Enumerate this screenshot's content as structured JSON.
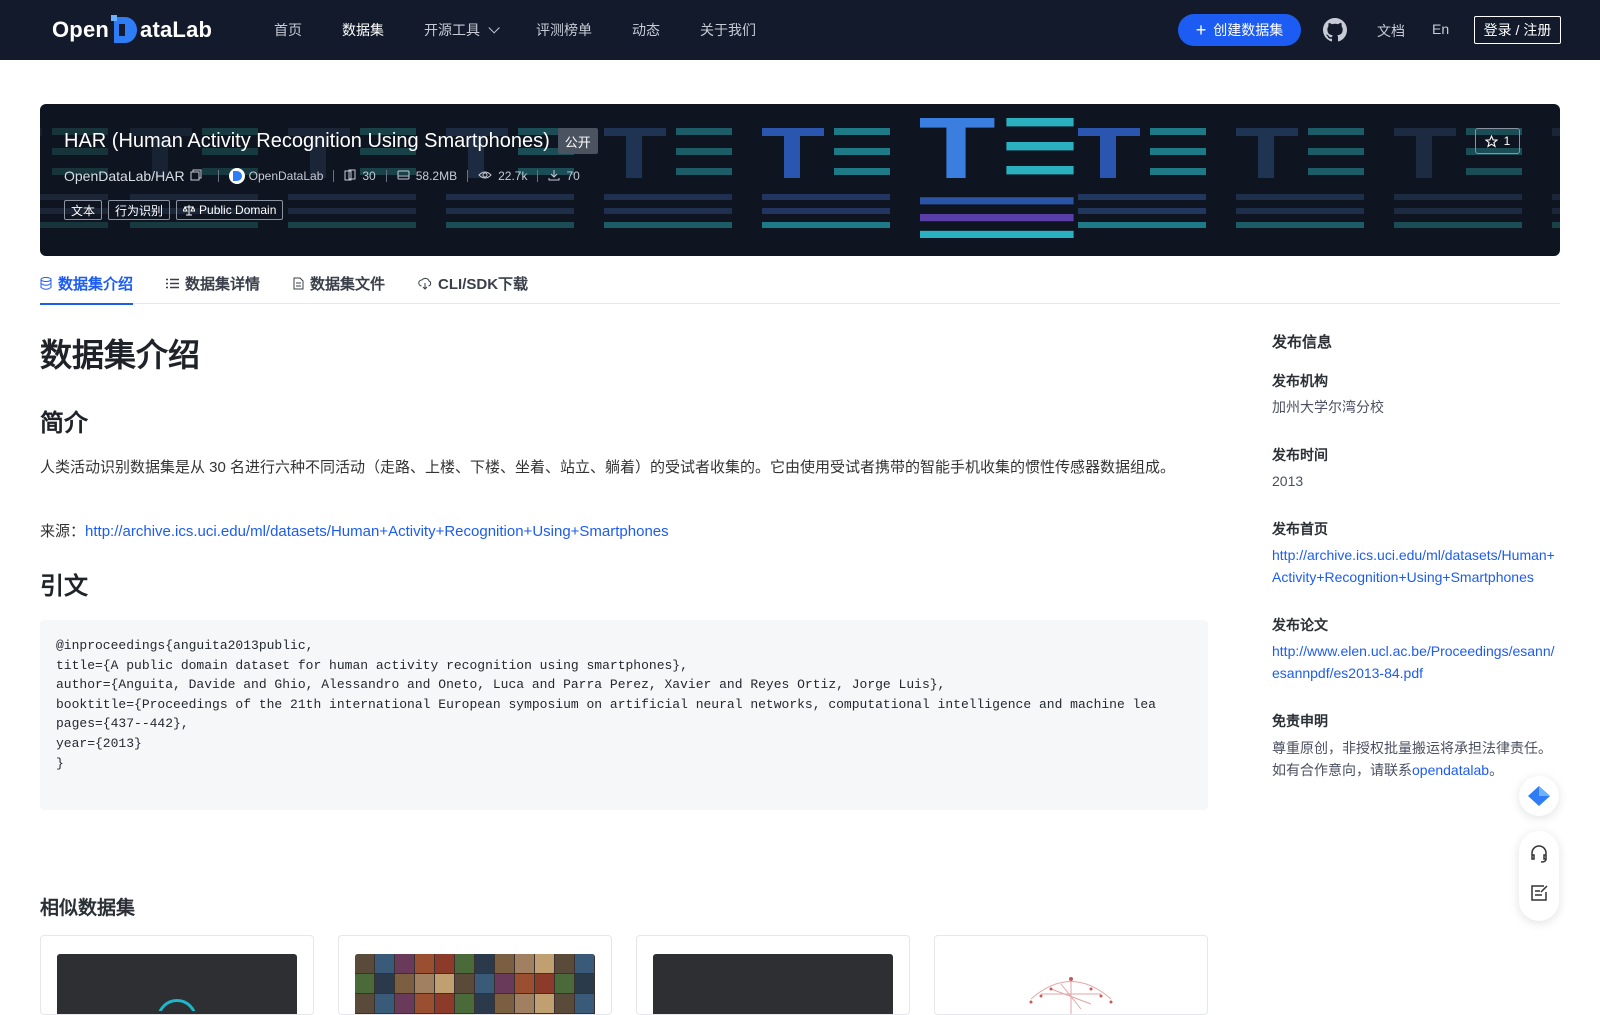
{
  "nav": {
    "logo_text_1": "Open",
    "logo_text_2": "ataLab",
    "links": [
      {
        "label": "首页",
        "active": false
      },
      {
        "label": "数据集",
        "active": true
      },
      {
        "label": "开源工具",
        "active": false,
        "dropdown": true
      },
      {
        "label": "评测榜单",
        "active": false
      },
      {
        "label": "动态",
        "active": false
      },
      {
        "label": "关于我们",
        "active": false
      }
    ],
    "create_label": "创建数据集",
    "doc_label": "文档",
    "lang_label": "En",
    "login_label": "登录 / 注册",
    "accent": "#1d5cf2",
    "bg": "#121a2b"
  },
  "banner": {
    "title": "HAR (Human Activity Recognition Using Smartphones)",
    "visibility": "公开",
    "path": "OpenDataLab/HAR",
    "org": "OpenDataLab",
    "files": "30",
    "size": "58.2MB",
    "views": "22.7k",
    "downloads": "70",
    "tags": [
      "文本",
      "行为识别"
    ],
    "license": "Public Domain",
    "stars": "1"
  },
  "tabs": [
    "数据集介绍",
    "数据集详情",
    "数据集文件",
    "CLI/SDK下载"
  ],
  "main": {
    "title": "数据集介绍",
    "intro_heading": "简介",
    "intro_text": "人类活动识别数据集是从 30 名进行六种不同活动（走路、上楼、下楼、坐着、站立、躺着）的受试者收集的。它由使用受试者携带的智能手机收集的惯性传感器数据组成。",
    "source_label": "来源：",
    "source_url": "http://archive.ics.uci.edu/ml/datasets/Human+Activity+Recognition+Using+Smartphones",
    "citation_heading": "引文",
    "citation": "@inproceedings{anguita2013public,\ntitle={A public domain dataset for human activity recognition using smartphones},\nauthor={Anguita, Davide and Ghio, Alessandro and Oneto, Luca and Parra Perez, Xavier and Reyes Ortiz, Jorge Luis},\nbooktitle={Proceedings of the 21th international European symposium on artificial neural networks, computational intelligence and machine lea\npages={437--442},\nyear={2013}\n}",
    "similar_heading": "相似数据集"
  },
  "sidebar": {
    "title": "发布信息",
    "org_label": "发布机构",
    "org_value": "加州大学尔湾分校",
    "time_label": "发布时间",
    "time_value": "2013",
    "home_label": "发布首页",
    "home_value": "http://archive.ics.uci.edu/ml/datasets/Human+Activity+Recognition+Using+Smartphones",
    "paper_label": "发布论文",
    "paper_value": "http://www.elen.ucl.ac.be/Proceedings/esann/esannpdf/es2013-84.pdf",
    "disclaimer_label": "免责申明",
    "disclaimer_text_1": "尊重原创，非授权批量搬运将承担法律责任。",
    "disclaimer_text_2": "如有合作意向，请联系",
    "disclaimer_link": "opendatalab",
    "disclaimer_end": "。"
  }
}
